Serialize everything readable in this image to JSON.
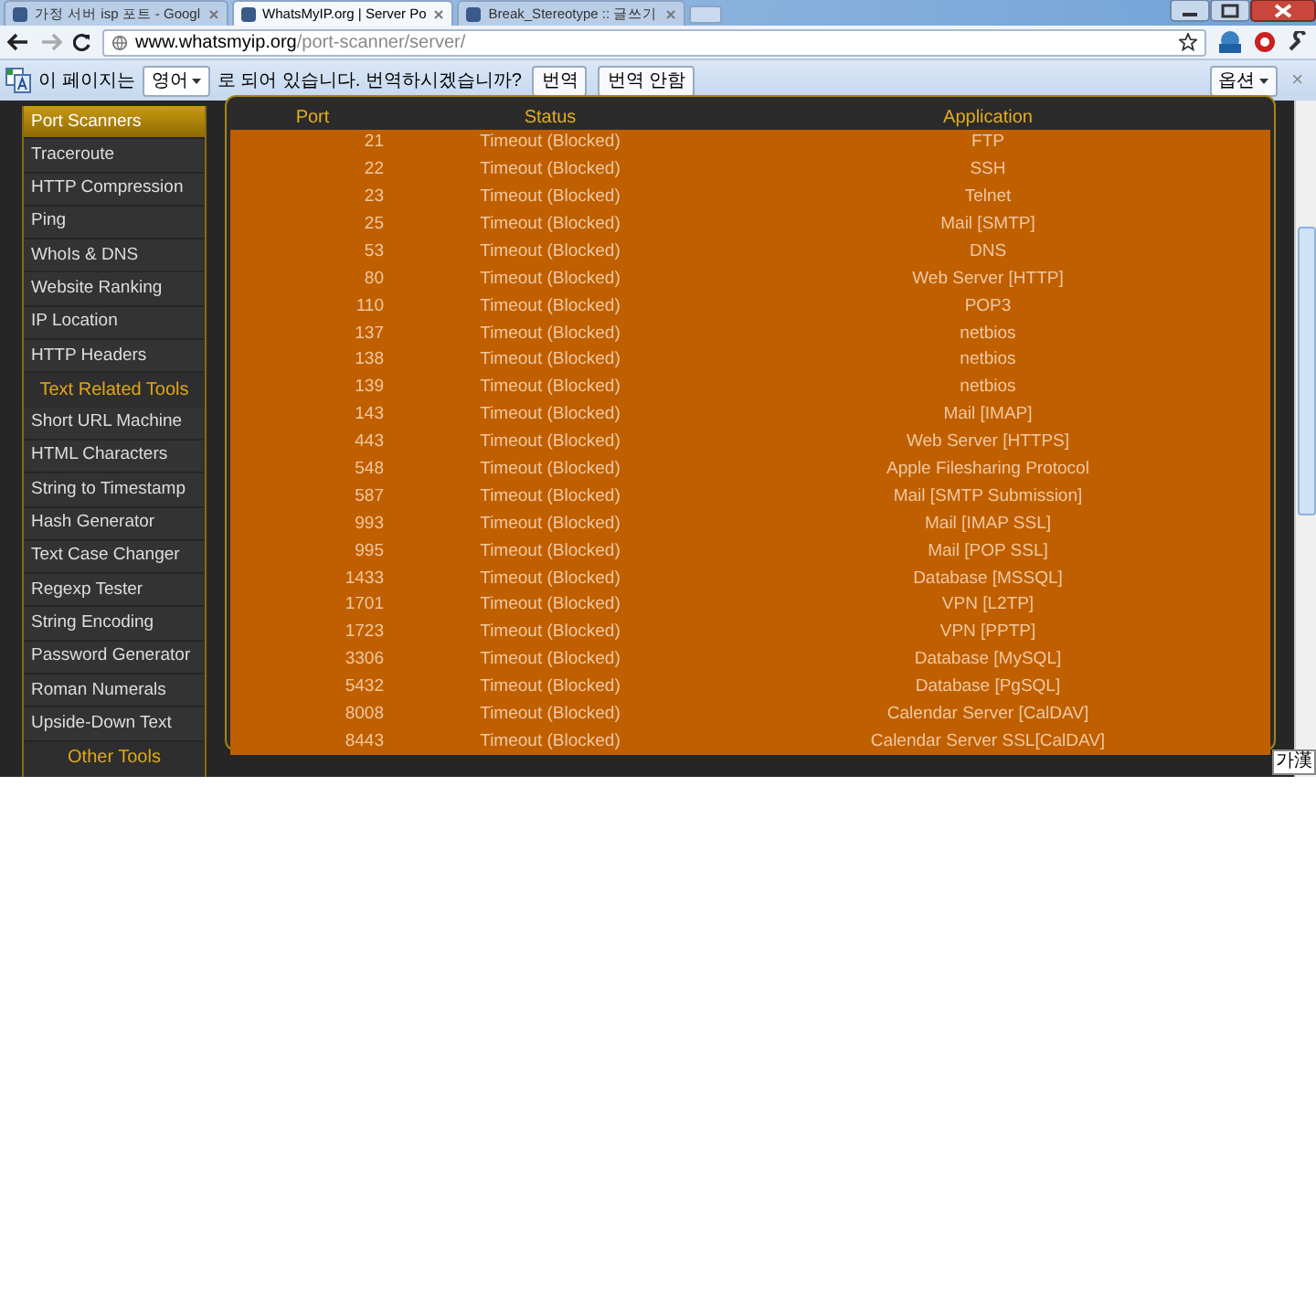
{
  "tabs": [
    {
      "title": "가정 서버 isp 포트 - Googl",
      "selected": false
    },
    {
      "title": "WhatsMyIP.org | Server Po",
      "selected": true
    },
    {
      "title": "Break_Stereotype :: 글쓰기",
      "selected": false
    }
  ],
  "address": {
    "domain": "www.whatsmyip.org",
    "path": "/port-scanner/server/"
  },
  "translate_bar": {
    "before": "이 페이지는",
    "language": "영어",
    "after": "로 되어 있습니다. 번역하시겠습니까?",
    "buttons": [
      "번역",
      "번역 안함"
    ],
    "options": "옵션",
    "close": "×"
  },
  "sidebar": {
    "items": [
      {
        "kind": "link",
        "label": "Port Scanners",
        "selected": true
      },
      {
        "kind": "link",
        "label": "Traceroute",
        "selected": false
      },
      {
        "kind": "link",
        "label": "HTTP Compression",
        "selected": false
      },
      {
        "kind": "link",
        "label": "Ping",
        "selected": false
      },
      {
        "kind": "link",
        "label": "WhoIs & DNS",
        "selected": false
      },
      {
        "kind": "link",
        "label": "Website Ranking",
        "selected": false
      },
      {
        "kind": "link",
        "label": "IP Location",
        "selected": false
      },
      {
        "kind": "link",
        "label": "HTTP Headers",
        "selected": false
      },
      {
        "kind": "heading",
        "label": "Text Related Tools"
      },
      {
        "kind": "link",
        "label": "Short URL Machine",
        "selected": false
      },
      {
        "kind": "link",
        "label": "HTML Characters",
        "selected": false
      },
      {
        "kind": "link",
        "label": "String to Timestamp",
        "selected": false
      },
      {
        "kind": "link",
        "label": "Hash Generator",
        "selected": false
      },
      {
        "kind": "link",
        "label": "Text Case Changer",
        "selected": false
      },
      {
        "kind": "link",
        "label": "Regexp Tester",
        "selected": false
      },
      {
        "kind": "link",
        "label": "String Encoding",
        "selected": false
      },
      {
        "kind": "link",
        "label": "Password Generator",
        "selected": false
      },
      {
        "kind": "link",
        "label": "Roman Numerals",
        "selected": false
      },
      {
        "kind": "link",
        "label": "Upside-Down Text",
        "selected": false
      },
      {
        "kind": "heading",
        "label": "Other Tools"
      }
    ]
  },
  "table": {
    "columns": [
      "Port",
      "Status",
      "Application"
    ],
    "rows": [
      {
        "port": "21",
        "status": "Timeout (Blocked)",
        "application": "FTP"
      },
      {
        "port": "22",
        "status": "Timeout (Blocked)",
        "application": "SSH"
      },
      {
        "port": "23",
        "status": "Timeout (Blocked)",
        "application": "Telnet"
      },
      {
        "port": "25",
        "status": "Timeout (Blocked)",
        "application": "Mail [SMTP]"
      },
      {
        "port": "53",
        "status": "Timeout (Blocked)",
        "application": "DNS"
      },
      {
        "port": "80",
        "status": "Timeout (Blocked)",
        "application": "Web Server [HTTP]"
      },
      {
        "port": "110",
        "status": "Timeout (Blocked)",
        "application": "POP3"
      },
      {
        "port": "137",
        "status": "Timeout (Blocked)",
        "application": "netbios"
      },
      {
        "port": "138",
        "status": "Timeout (Blocked)",
        "application": "netbios"
      },
      {
        "port": "139",
        "status": "Timeout (Blocked)",
        "application": "netbios"
      },
      {
        "port": "143",
        "status": "Timeout (Blocked)",
        "application": "Mail [IMAP]"
      },
      {
        "port": "443",
        "status": "Timeout (Blocked)",
        "application": "Web Server [HTTPS]"
      },
      {
        "port": "548",
        "status": "Timeout (Blocked)",
        "application": "Apple Filesharing Protocol"
      },
      {
        "port": "587",
        "status": "Timeout (Blocked)",
        "application": "Mail [SMTP Submission]"
      },
      {
        "port": "993",
        "status": "Timeout (Blocked)",
        "application": "Mail [IMAP SSL]"
      },
      {
        "port": "995",
        "status": "Timeout (Blocked)",
        "application": "Mail [POP SSL]"
      },
      {
        "port": "1433",
        "status": "Timeout (Blocked)",
        "application": "Database [MSSQL]"
      },
      {
        "port": "1701",
        "status": "Timeout (Blocked)",
        "application": "VPN [L2TP]"
      },
      {
        "port": "1723",
        "status": "Timeout (Blocked)",
        "application": "VPN [PPTP]"
      },
      {
        "port": "3306",
        "status": "Timeout (Blocked)",
        "application": "Database [MySQL]"
      },
      {
        "port": "5432",
        "status": "Timeout (Blocked)",
        "application": "Database [PgSQL]"
      },
      {
        "port": "8008",
        "status": "Timeout (Blocked)",
        "application": "Calendar Server [CalDAV]"
      },
      {
        "port": "8443",
        "status": "Timeout (Blocked)",
        "application": "Calendar Server SSL[CalDAV]"
      }
    ]
  },
  "ime": "가漢"
}
